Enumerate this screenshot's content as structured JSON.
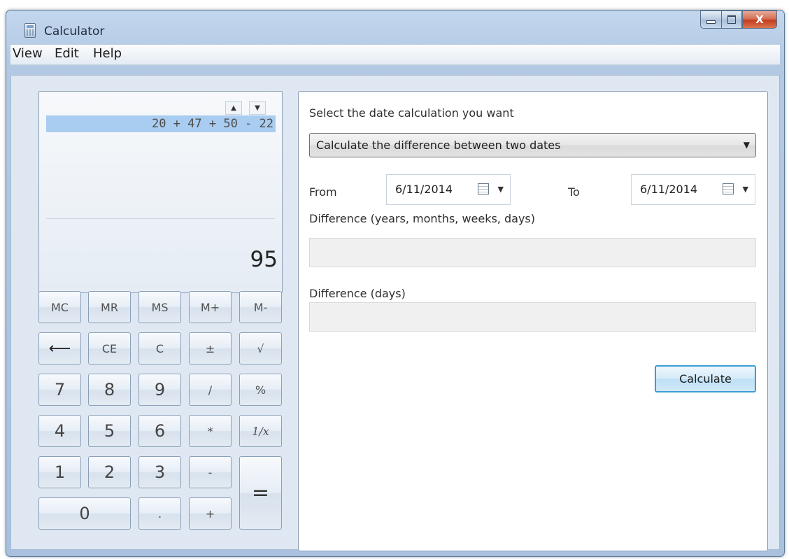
{
  "window": {
    "title": "Calculator",
    "close_glyph": "X"
  },
  "menu": {
    "items": [
      "View",
      "Edit",
      "Help"
    ]
  },
  "display": {
    "history_up": "▲",
    "history_down": "▼",
    "expression": "20 + 47 + 50 - 22",
    "value": "95"
  },
  "keypad": {
    "memory": [
      "MC",
      "MR",
      "MS",
      "M+",
      "M-"
    ],
    "row2": [
      "⟵",
      "CE",
      "C",
      "±",
      "√"
    ],
    "row3": [
      "7",
      "8",
      "9",
      "/",
      "%"
    ],
    "row4": [
      "4",
      "5",
      "6",
      "*",
      "1/x"
    ],
    "row5": [
      "1",
      "2",
      "3",
      "-"
    ],
    "row6": [
      "0",
      ".",
      "+"
    ],
    "equals": "="
  },
  "date_panel": {
    "prompt": "Select the date calculation you want",
    "mode_selected": "Calculate the difference between two dates",
    "from_label": "From",
    "from_value": "6/11/2014",
    "to_label": "To",
    "to_value": "6/11/2014",
    "diff_ymwd_label": "Difference (years, months, weeks, days)",
    "diff_ymwd_value": "",
    "diff_days_label": "Difference (days)",
    "diff_days_value": "",
    "calculate_label": "Calculate"
  },
  "colors": {
    "accent": "#3c9ed6",
    "expression_highlight": "#a9cdf1",
    "window_frame": "#b3c9e3",
    "close_button": "#c1391c"
  }
}
